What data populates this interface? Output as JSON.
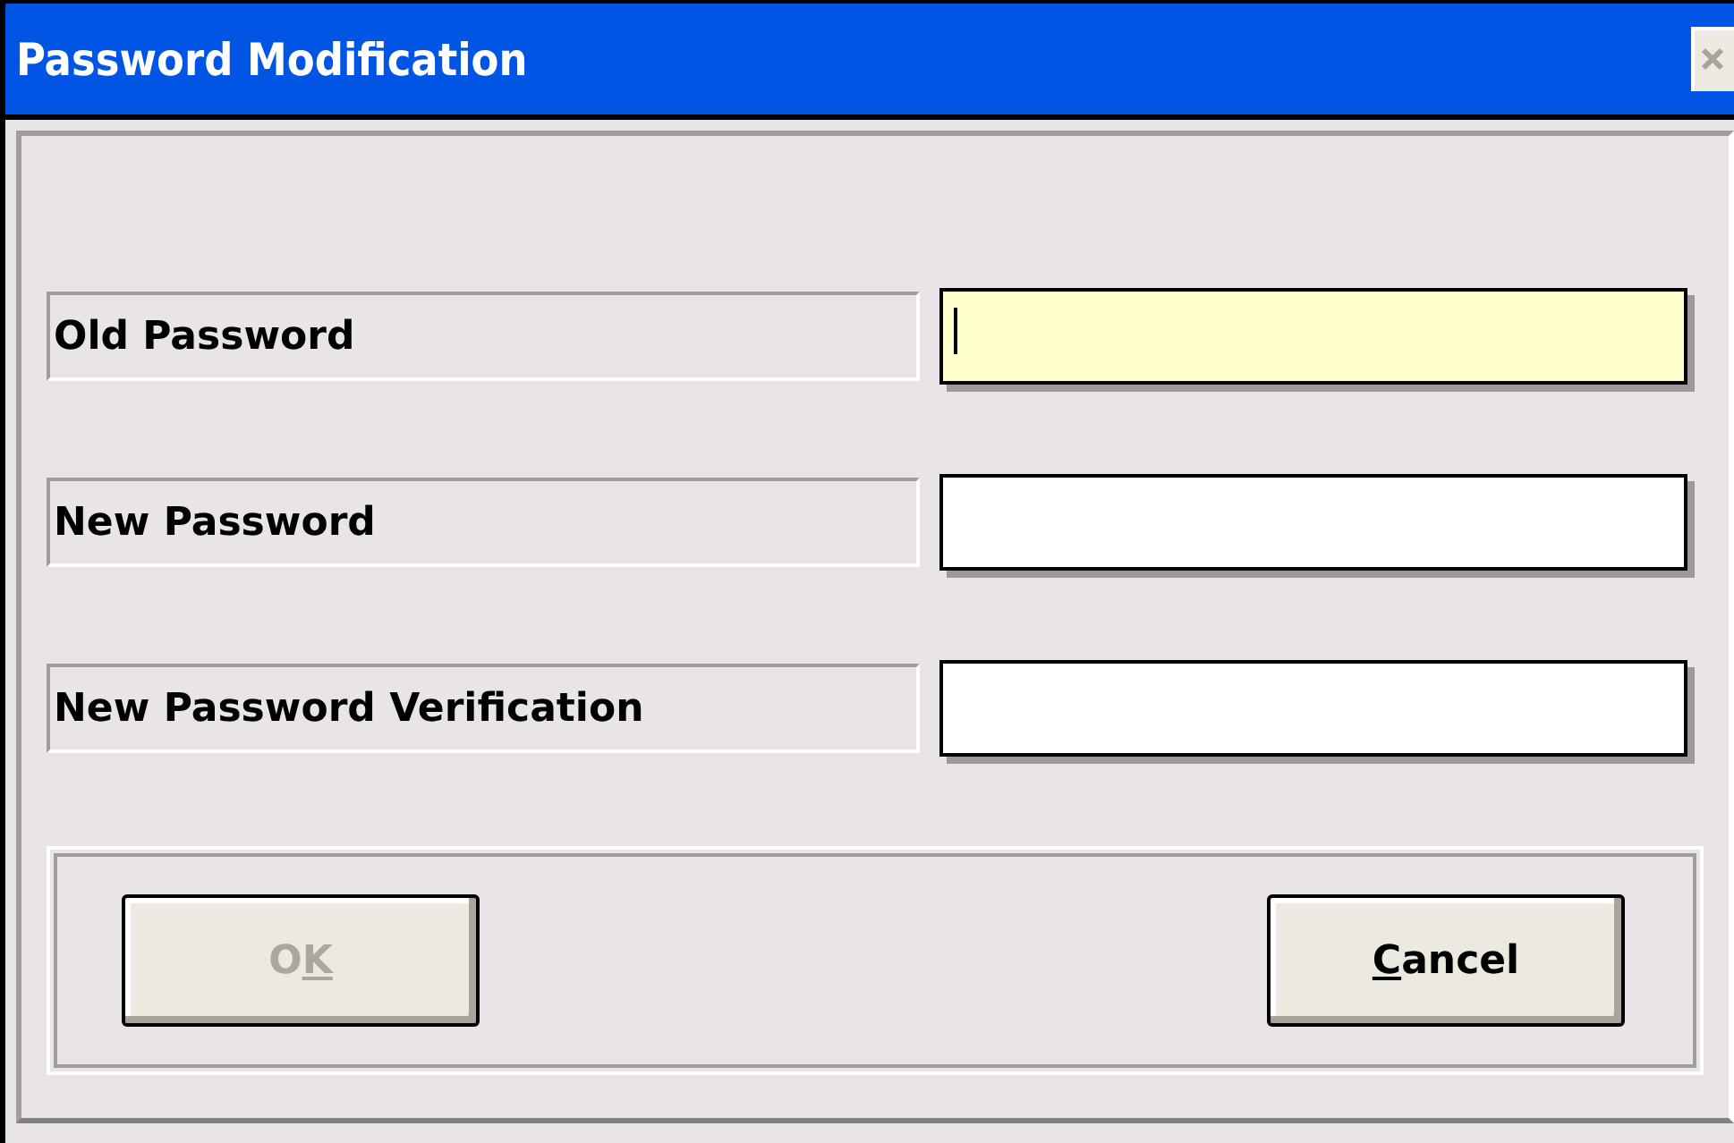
{
  "window": {
    "title": "Password Modification"
  },
  "fields": [
    {
      "label": "Old Password",
      "focused": true
    },
    {
      "label": "New Password",
      "focused": false
    },
    {
      "label": "New Password Verification",
      "focused": false
    }
  ],
  "buttons": [
    {
      "label_parts": [
        {
          "text": "O",
          "underlined": false
        },
        {
          "text": "K",
          "underlined": true
        }
      ],
      "disabled": true
    },
    {
      "label_parts": [
        {
          "text": "C",
          "underlined": true
        },
        {
          "text": "ancel",
          "underlined": false
        }
      ],
      "disabled": false
    }
  ]
}
